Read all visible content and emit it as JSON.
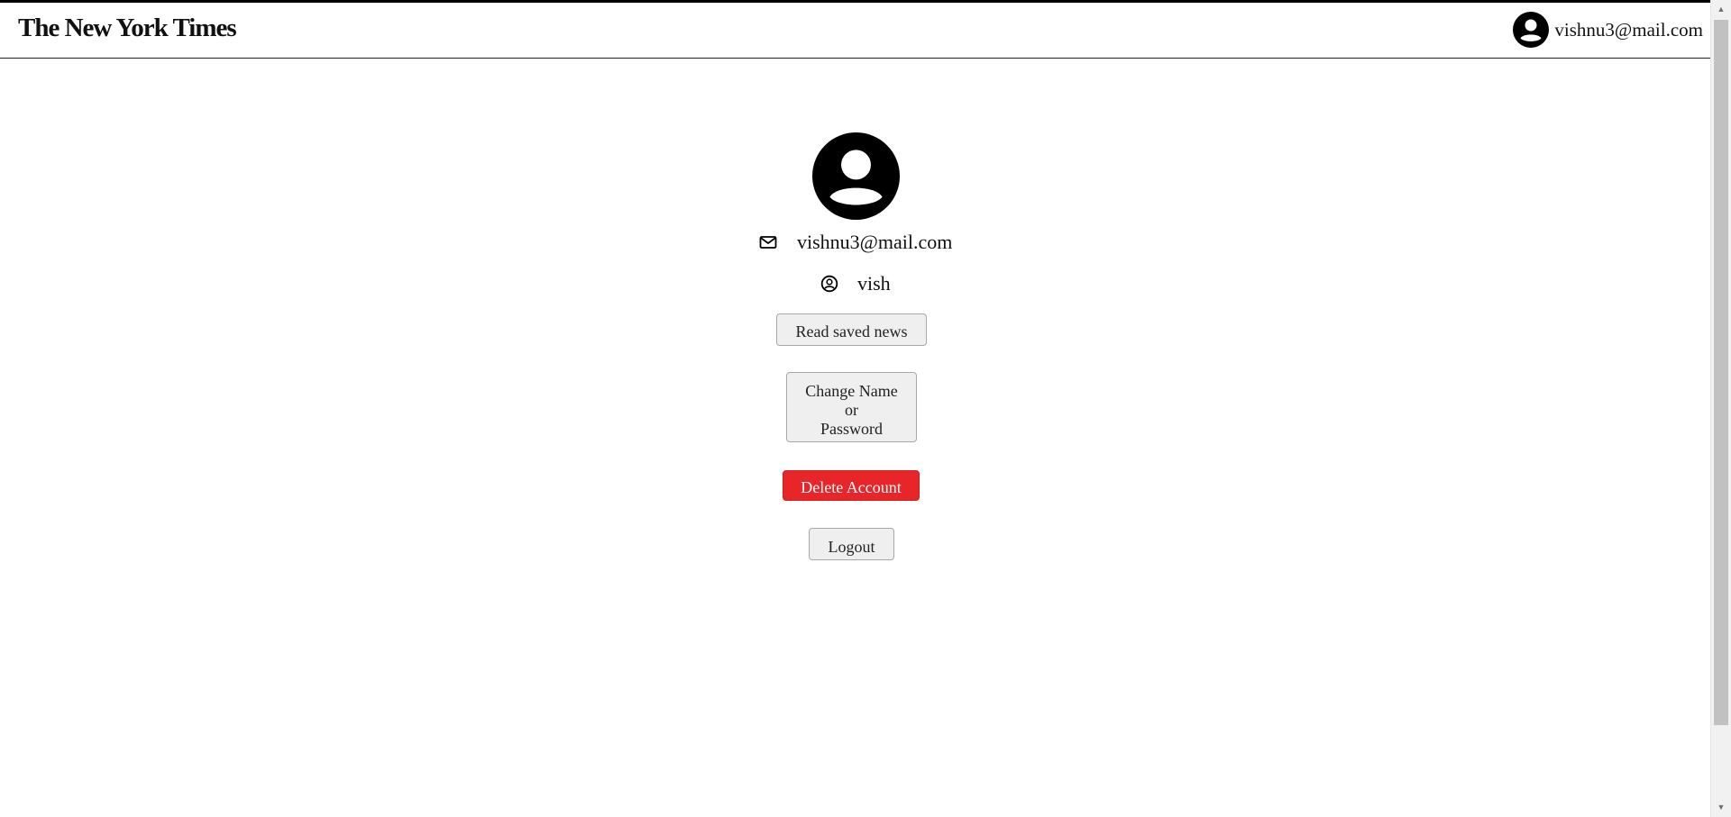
{
  "header": {
    "logo_text": "The New York Times",
    "user_email": "vishnu3@mail.com"
  },
  "profile": {
    "email": "vishnu3@mail.com",
    "name": "vish"
  },
  "actions": {
    "read_saved_label": "Read saved news",
    "change_line1": "Change Name",
    "change_line2": "or",
    "change_line3": "Password",
    "delete_label": "Delete Account",
    "logout_label": "Logout"
  },
  "colors": {
    "delete_bg": "#e8262a",
    "button_bg": "#efefef"
  },
  "icons": {
    "header_avatar": "user-circle-icon",
    "profile_avatar": "user-circle-icon",
    "email": "mail-icon",
    "name": "user-circle-outline-icon"
  }
}
